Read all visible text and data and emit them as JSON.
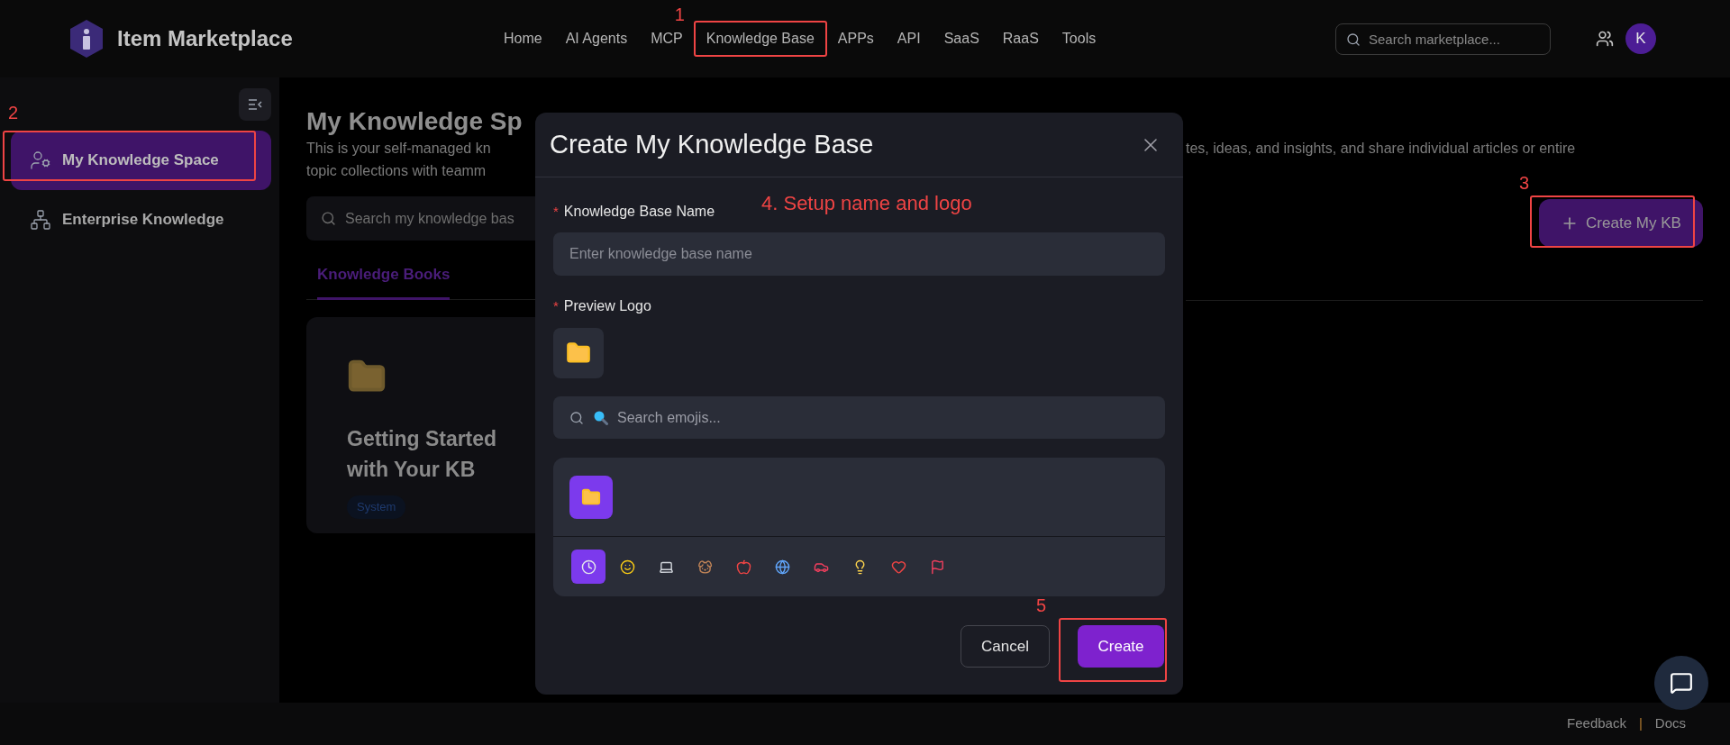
{
  "header": {
    "logo_text": "Item Marketplace",
    "nav": [
      {
        "label": "Home"
      },
      {
        "label": "AI Agents"
      },
      {
        "label": "MCP"
      },
      {
        "label": "Knowledge Base",
        "marker": "1"
      },
      {
        "label": "APPs"
      },
      {
        "label": "API"
      },
      {
        "label": "SaaS"
      },
      {
        "label": "RaaS"
      },
      {
        "label": "Tools"
      }
    ],
    "search": {
      "placeholder": "Search marketplace..."
    },
    "avatar": "K"
  },
  "sidebar": {
    "items": [
      {
        "label": "My Knowledge Space",
        "kind": "personal",
        "selected": true,
        "marker": "2"
      },
      {
        "label": "Enterprise Knowledge",
        "kind": "enterprise",
        "selected": false
      }
    ]
  },
  "page": {
    "title": "My Knowledge Sp",
    "description_left": [
      "This is your self-managed kn",
      "topic collections with teamm"
    ],
    "description_right": "tes, ideas, and insights, and share individual articles or entire",
    "search": {
      "placeholder": "Search my knowledge bas"
    },
    "create_button": {
      "label": "Create My KB",
      "marker": "3"
    },
    "tabs": [
      {
        "label": "Knowledge Books",
        "selected": true
      }
    ],
    "cards": [
      {
        "title": "Getting Started with Your KB",
        "tag": "System"
      }
    ]
  },
  "dialog": {
    "title": "Create My Knowledge Base",
    "note": "4. Setup name and logo",
    "name_field": {
      "label": "Knowledge Base Name",
      "required_mark": "*",
      "placeholder": "Enter knowledge base name"
    },
    "logo_field": {
      "label": "Preview Logo",
      "required_mark": "*"
    },
    "emoji_search": {
      "placeholder": "Search emojis..."
    },
    "emoji_categories": [
      {
        "kind": "clock",
        "selected": true
      },
      {
        "kind": "smiley",
        "selected": false
      },
      {
        "kind": "laptop",
        "selected": false
      },
      {
        "kind": "dog",
        "selected": false
      },
      {
        "kind": "apple",
        "selected": false
      },
      {
        "kind": "globe",
        "selected": false
      },
      {
        "kind": "car",
        "selected": false
      },
      {
        "kind": "bulb",
        "selected": false
      },
      {
        "kind": "heart",
        "selected": false
      },
      {
        "kind": "flag",
        "selected": false
      }
    ],
    "buttons": [
      {
        "label": "Cancel",
        "kind": "secondary"
      },
      {
        "label": "Create",
        "kind": "primary",
        "marker": "5"
      }
    ]
  },
  "footer": {
    "links": [
      "Feedback",
      "Docs"
    ],
    "separator": "|"
  }
}
